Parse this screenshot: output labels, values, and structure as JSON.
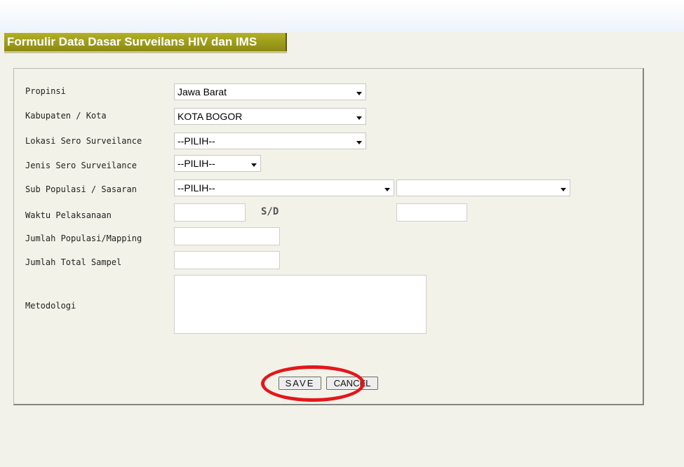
{
  "page": {
    "title": "Formulir Data Dasar Surveilans HIV dan IMS"
  },
  "form": {
    "fields": {
      "propinsi": {
        "label": "Propinsi",
        "value": "Jawa Barat"
      },
      "kabupaten": {
        "label": "Kabupaten / Kota",
        "value": "KOTA BOGOR"
      },
      "lokasi": {
        "label": "Lokasi Sero Surveilance",
        "value": "--PILIH--"
      },
      "jenis": {
        "label": "Jenis Sero Surveilance",
        "value": "--PILIH--"
      },
      "subpopulasi": {
        "label": "Sub Populasi / Sasaran",
        "value": "--PILIH--",
        "value2": ""
      },
      "waktu": {
        "label": "Waktu Pelaksanaan",
        "separator": "S/D",
        "start": "",
        "end": ""
      },
      "jumlah_populasi": {
        "label": "Jumlah Populasi/Mapping",
        "value": ""
      },
      "jumlah_sampel": {
        "label": "Jumlah Total Sampel",
        "value": ""
      },
      "metodologi": {
        "label": "Metodologi",
        "value": ""
      }
    },
    "buttons": {
      "save": "SAVE",
      "cancel": "CANCEL"
    }
  },
  "colors": {
    "title_bar": "#9e9d1a",
    "highlight": "#e4161b",
    "panel": "#f2f2e8"
  }
}
